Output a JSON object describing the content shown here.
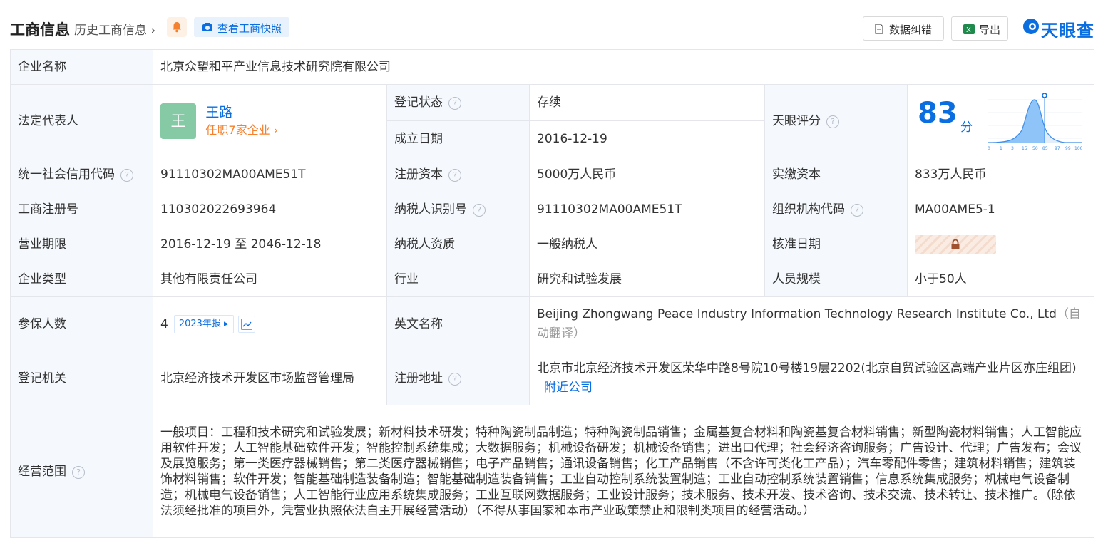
{
  "header": {
    "title": "工商信息",
    "history_link": "历史工商信息",
    "snapshot_label": "查看工商快照",
    "data_error_label": "数据纠错",
    "export_label": "导出",
    "brand": "天眼查",
    "brand_color": "#0a6de0"
  },
  "company": {
    "name_label": "企业名称",
    "name": "北京众望和平产业信息技术研究院有限公司",
    "legal_rep_label": "法定代表人",
    "legal_rep_avatar": "王",
    "legal_rep_name": "王路",
    "legal_rep_jobs": "任职7家企业",
    "status_label": "登记状态",
    "status": "存续",
    "found_label": "成立日期",
    "found_date": "2016-12-19",
    "score_label": "天眼评分",
    "score": "83",
    "score_unit": "分",
    "score_axis": [
      "0",
      "1",
      "3",
      "15",
      "50",
      "85",
      "97",
      "99",
      "100"
    ],
    "credit_label": "统一社会信用代码",
    "credit_code": "91110302MA00AME51T",
    "reg_capital_label": "注册资本",
    "reg_capital": "5000万人民币",
    "paid_capital_label": "实缴资本",
    "paid_capital": "833万人民币",
    "reg_no_label": "工商注册号",
    "reg_no": "110302022693964",
    "taxpayer_id_label": "纳税人识别号",
    "taxpayer_id": "91110302MA00AME51T",
    "org_code_label": "组织机构代码",
    "org_code": "MA00AME5-1",
    "term_label": "营业期限",
    "term": "2016-12-19 至 2046-12-18",
    "taxpayer_type_label": "纳税人资质",
    "taxpayer_type": "一般纳税人",
    "approve_label": "核准日期",
    "type_label": "企业类型",
    "type": "其他有限责任公司",
    "industry_label": "行业",
    "industry": "研究和试验发展",
    "staff_label": "人员规模",
    "staff": "小于50人",
    "insured_label": "参保人数",
    "insured": "4",
    "insured_year": "2023年报",
    "en_name_label": "英文名称",
    "en_name": "Beijing Zhongwang Peace Industry Information Technology Research Institute Co., Ltd",
    "en_name_note": "（自动翻译）",
    "authority_label": "登记机关",
    "authority": "北京经济技术开发区市场监督管理局",
    "address_label": "注册地址",
    "address": "北京市北京经济技术开发区荣华中路8号院10号楼19层2202(北京自贸试验区高端产业片区亦庄组团)",
    "nearby": "附近公司",
    "scope_label": "经营范围",
    "scope": "一般项目：工程和技术研究和试验发展；新材料技术研发；特种陶瓷制品制造；特种陶瓷制品销售；金属基复合材料和陶瓷基复合材料销售；新型陶瓷材料销售；人工智能应用软件开发；人工智能基础软件开发；智能控制系统集成；大数据服务；机械设备研发；机械设备销售；进出口代理；社会经济咨询服务；广告设计、代理；广告发布；会议及展览服务；第一类医疗器械销售；第二类医疗器械销售；电子产品销售；通讯设备销售；化工产品销售（不含许可类化工产品）；汽车零配件零售；建筑材料销售；建筑装饰材料销售；软件开发；智能基础制造装备制造；智能基础制造装备销售；工业自动控制系统装置制造；工业自动控制系统装置销售；信息系统集成服务；机械电气设备制造；机械电气设备销售；人工智能行业应用系统集成服务；工业互联网数据服务；工业设计服务；技术服务、技术开发、技术咨询、技术交流、技术转让、技术推广。（除依法须经批准的项目外，凭营业执照依法自主开展经营活动）（不得从事国家和本市产业政策禁止和限制类项目的经营活动。）"
  }
}
